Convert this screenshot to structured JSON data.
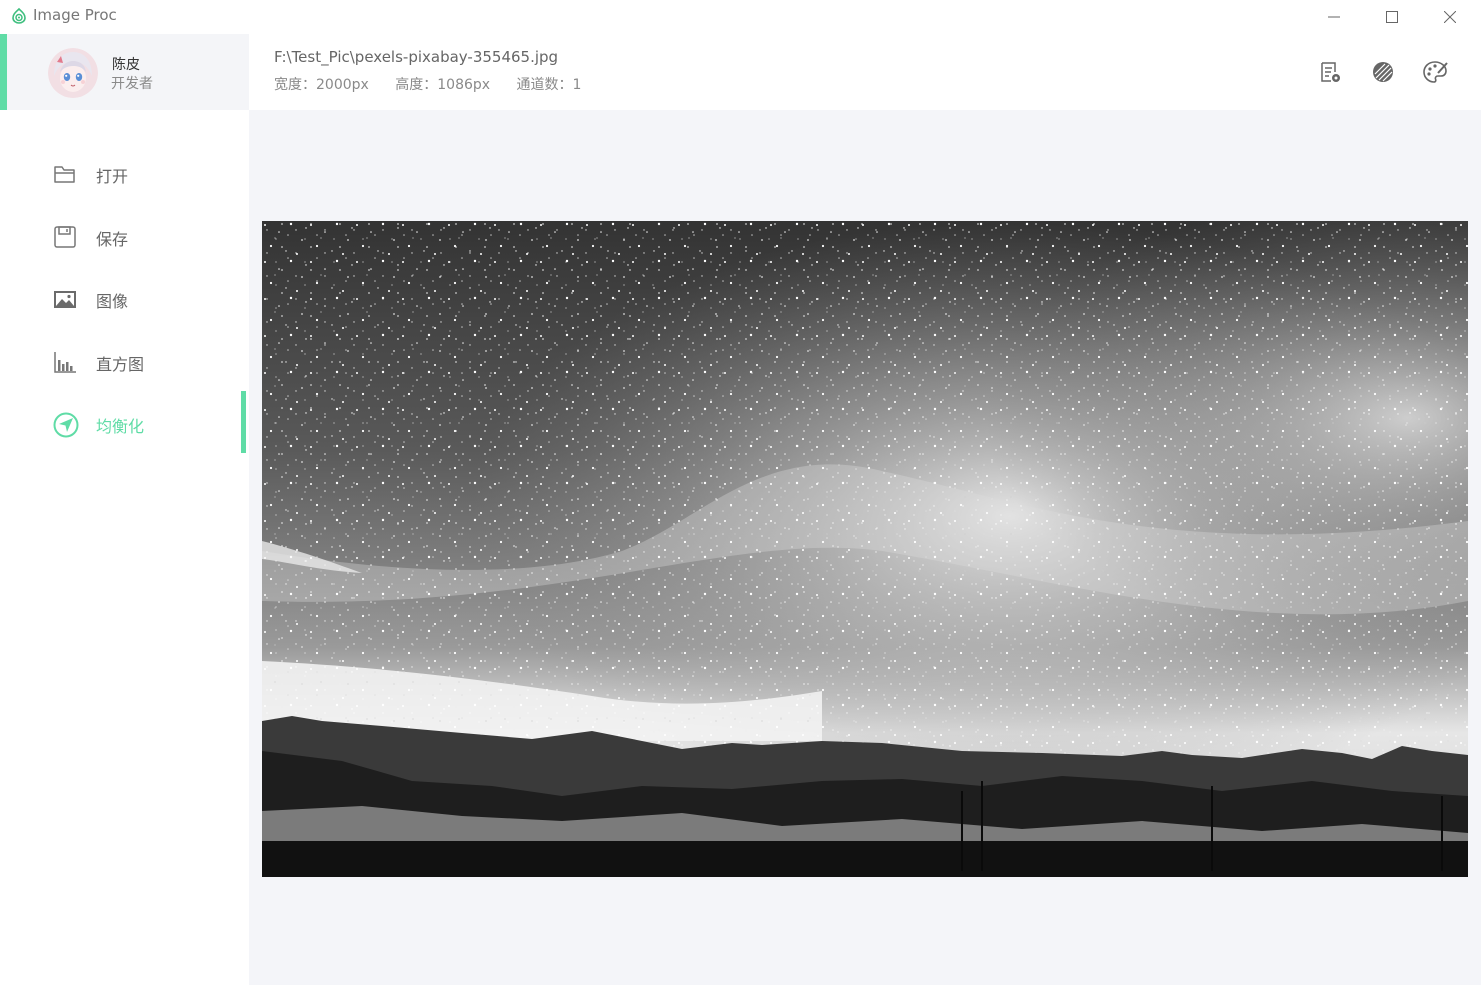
{
  "window": {
    "title": "Image Proc",
    "controls": {
      "minimize": "minimize-icon",
      "maximize": "maximize-icon",
      "close": "close-icon"
    }
  },
  "user": {
    "name": "陈皮",
    "role": "开发者"
  },
  "sidebar": {
    "items": [
      {
        "label": "打开",
        "icon": "folder-icon",
        "active": false
      },
      {
        "label": "保存",
        "icon": "save-icon",
        "active": false
      },
      {
        "label": "图像",
        "icon": "image-icon",
        "active": false
      },
      {
        "label": "直方图",
        "icon": "histogram-icon",
        "active": false
      },
      {
        "label": "均衡化",
        "icon": "equalize-icon",
        "active": true
      }
    ]
  },
  "file": {
    "path": "F:\\Test_Pic\\pexels-pixabay-355465.jpg",
    "width": "宽度：2000px",
    "height": "高度：1086px",
    "channels": "通道数：1"
  },
  "toolbar": {
    "buttons": [
      "report-icon",
      "contrast-icon",
      "palette-icon"
    ]
  },
  "image": {
    "description_icon": "grayscale-starry-night-image"
  },
  "colors": {
    "accent": "#5fdca6",
    "canvas_bg": "#f4f5f9",
    "profile_bg": "#f4f5f8"
  }
}
